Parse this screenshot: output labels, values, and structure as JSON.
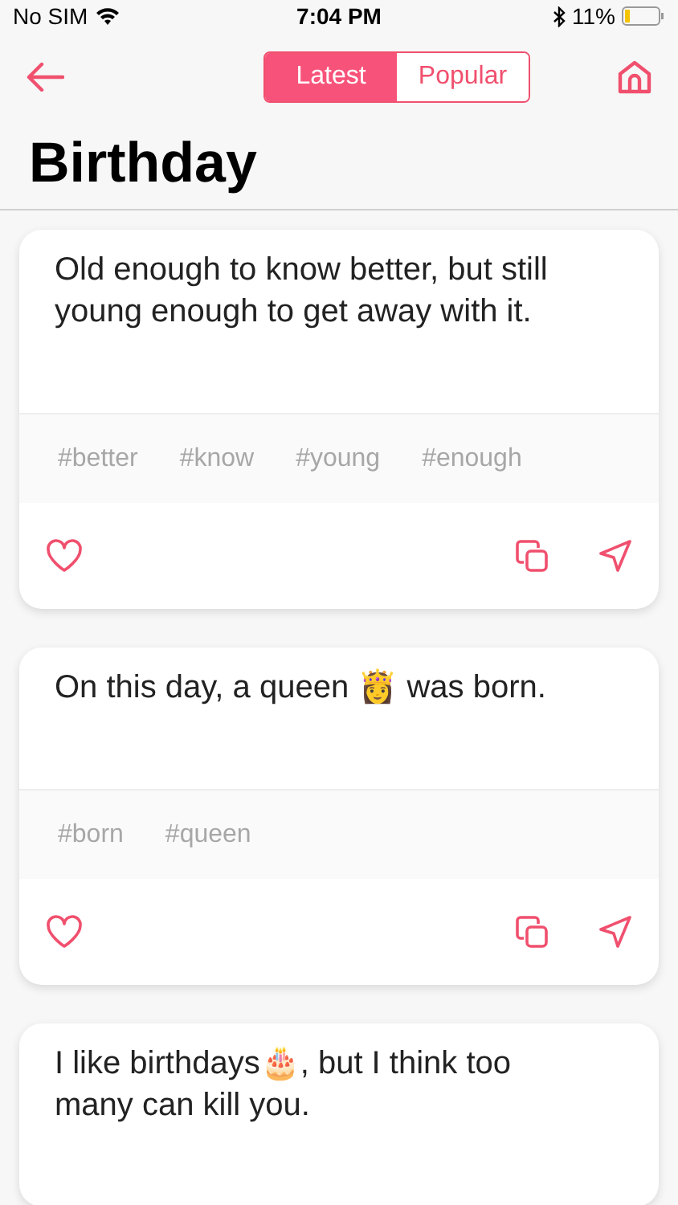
{
  "status_bar": {
    "carrier": "No SIM",
    "time": "7:04 PM",
    "battery": "11%"
  },
  "tabs": [
    {
      "label": "Latest",
      "selected": true
    },
    {
      "label": "Popular",
      "selected": false
    }
  ],
  "title": "Birthday",
  "quotes": [
    {
      "text": "Old enough to know better, but still young enough to get away with it.",
      "tags": [
        "#better",
        "#know",
        "#young",
        "#enough"
      ]
    },
    {
      "text": "On this day, a queen 👸 was born.",
      "tags": [
        "#born",
        "#queen"
      ]
    },
    {
      "text": "I like birthdays🎂, but I think too many can kill you."
    }
  ]
}
